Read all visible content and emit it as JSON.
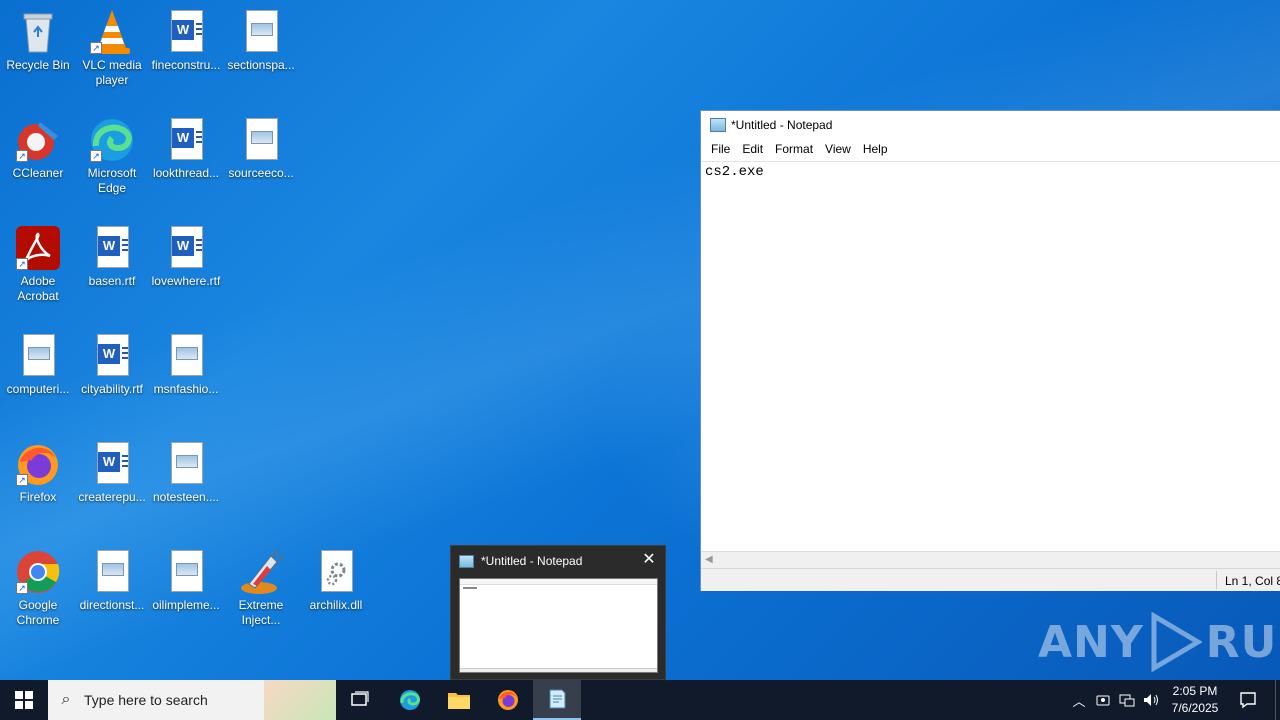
{
  "desktop": {
    "icons": [
      {
        "label": "Recycle Bin"
      },
      {
        "label": "VLC media player"
      },
      {
        "label": "fineconstru..."
      },
      {
        "label": "sectionspa..."
      },
      {
        "label": "CCleaner"
      },
      {
        "label": "Microsoft Edge"
      },
      {
        "label": "lookthread..."
      },
      {
        "label": "sourceeco..."
      },
      {
        "label": "Adobe Acrobat"
      },
      {
        "label": "basen.rtf"
      },
      {
        "label": "lovewhere.rtf"
      },
      {
        "label": "computeri..."
      },
      {
        "label": "cityability.rtf"
      },
      {
        "label": "msnfashio..."
      },
      {
        "label": "Firefox"
      },
      {
        "label": "createrepu..."
      },
      {
        "label": "notesteen...."
      },
      {
        "label": "Google Chrome"
      },
      {
        "label": "directionst..."
      },
      {
        "label": "oilimpleme..."
      },
      {
        "label": "Extreme Inject..."
      },
      {
        "label": "archilix.dll"
      }
    ]
  },
  "notepad": {
    "title": "*Untitled - Notepad",
    "menu": [
      "File",
      "Edit",
      "Format",
      "View",
      "Help"
    ],
    "content": "cs2.exe",
    "status_position": "Ln 1, Col 8"
  },
  "thumbnail": {
    "title": "*Untitled - Notepad",
    "close_glyph": "✕"
  },
  "watermark": {
    "left": "ANY",
    "right": "RUN"
  },
  "taskbar": {
    "search_placeholder": "Type here to search",
    "time": "2:05 PM",
    "date": "7/6/2025"
  },
  "colors": {
    "taskbar_bg": "#111a2a",
    "accent": "#8cc4f5"
  }
}
